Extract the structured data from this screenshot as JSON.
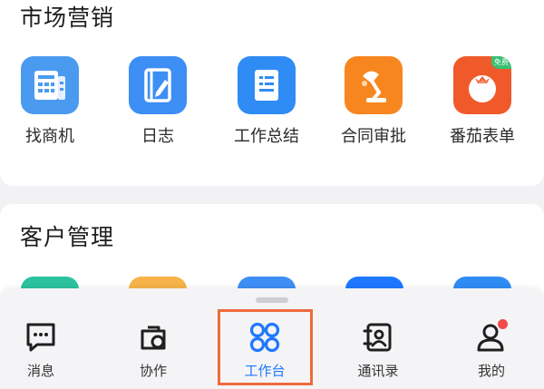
{
  "sections": {
    "market": {
      "title": "市场营销",
      "apps": [
        {
          "label": "找商机",
          "icon": "business-opportunity-icon",
          "color": "#4a9bf0"
        },
        {
          "label": "日志",
          "icon": "log-notebook-icon",
          "color": "#3d8ef5"
        },
        {
          "label": "工作总结",
          "icon": "work-summary-icon",
          "color": "#2f8cf4"
        },
        {
          "label": "合同审批",
          "icon": "desk-lamp-icon",
          "color": "#f8861f"
        },
        {
          "label": "番茄表单",
          "icon": "tomato-icon",
          "color": "#f05a2b",
          "badge": "免费"
        }
      ]
    },
    "customer": {
      "title": "客户管理",
      "peek_colors": [
        "#2cc2a0",
        "#f7b24a",
        "#3d8ef5",
        "#1e78ff",
        "#2f8cf4"
      ]
    }
  },
  "tabbar": {
    "tabs": [
      {
        "label": "消息",
        "icon": "chat-bubble-icon"
      },
      {
        "label": "协作",
        "icon": "collaboration-icon"
      },
      {
        "label": "工作台",
        "icon": "workbench-grid-icon",
        "active": true
      },
      {
        "label": "通讯录",
        "icon": "contacts-book-icon"
      },
      {
        "label": "我的",
        "icon": "profile-icon",
        "has_notification_dot": true
      }
    ],
    "active_color": "#1e78ff",
    "highlight_color": "#ee6a3c"
  }
}
